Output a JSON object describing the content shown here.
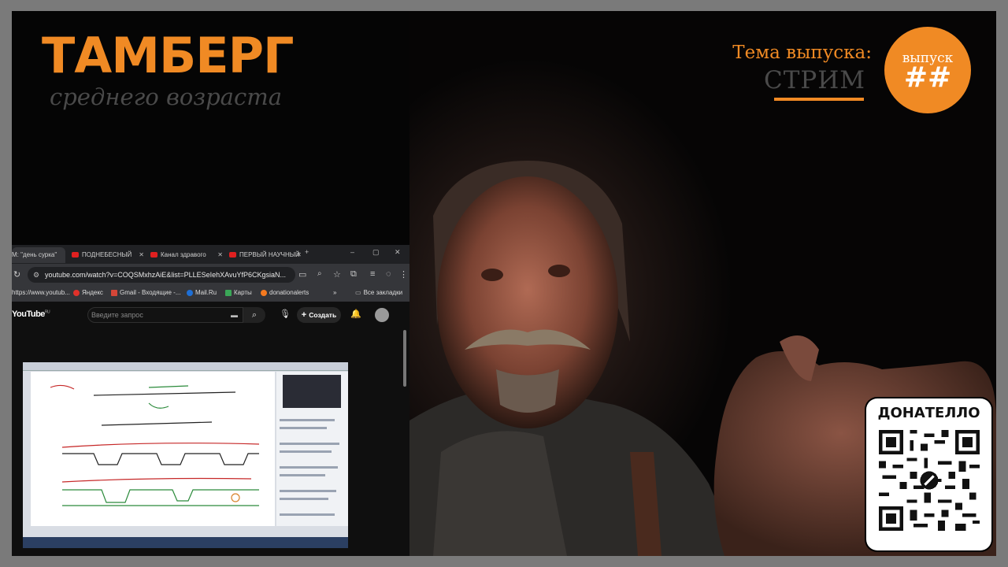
{
  "overlay": {
    "logo_title": "ТАМБЕРГ",
    "logo_subtitle": "среднего возраста",
    "topic_label": "Тема выпуска:",
    "topic_value": "СТРИМ",
    "episode_label": "выпуск",
    "episode_number": "##",
    "donation_title": "ДОНАТЕЛЛО",
    "accent_color": "#f08a24"
  },
  "browser": {
    "tabs": [
      {
        "label": "M: \"день сурка\"",
        "icon": "mail-icon"
      },
      {
        "label": "ПОДНЕБЕСНЫЙ",
        "icon": "youtube-icon"
      },
      {
        "label": "Канал здравого",
        "icon": "youtube-icon"
      },
      {
        "label": "ПЕРВЫЙ НАУЧНЫЙ",
        "icon": "youtube-icon"
      }
    ],
    "url": "youtube.com/watch?v=COQSMxhzAiE&list=PLLESeIehXAvuYfP6CKgsiaN...",
    "bookmarks": [
      {
        "label": "https://www.youtub...",
        "icon": "globe-icon"
      },
      {
        "label": "Яндекс",
        "icon": "yandex-icon"
      },
      {
        "label": "Gmail - Входящие -...",
        "icon": "gmail-icon"
      },
      {
        "label": "Mail.Ru",
        "icon": "mailru-icon"
      },
      {
        "label": "Карты",
        "icon": "maps-icon"
      },
      {
        "label": "donationalerts",
        "icon": "donationalerts-icon"
      }
    ],
    "all_bookmarks": "Все закладки",
    "youtube": {
      "logo": "YouTube",
      "region": "RU",
      "search_placeholder": "Введите запрос",
      "create_label": "Создать"
    }
  }
}
